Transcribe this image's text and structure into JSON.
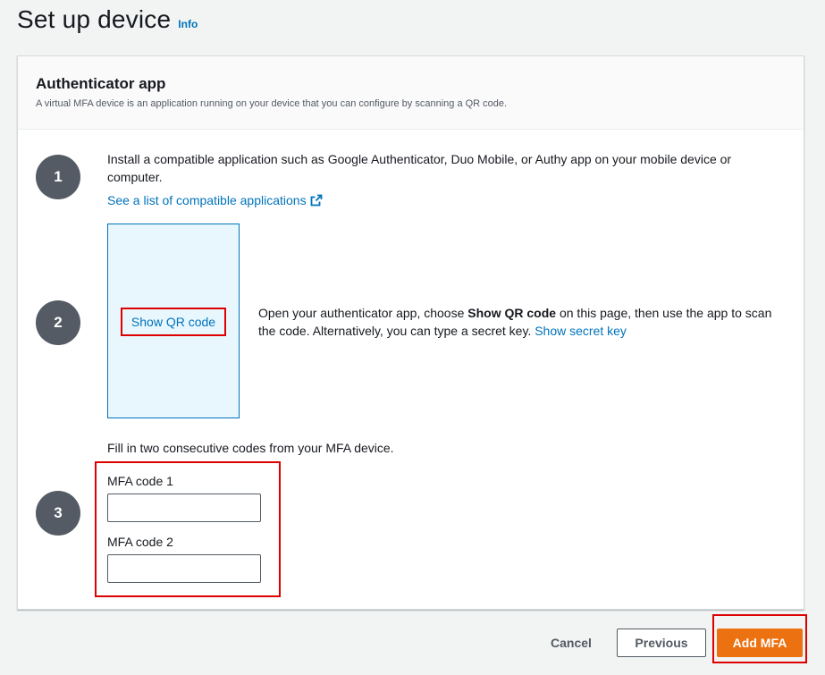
{
  "page": {
    "title": "Set up device",
    "info_label": "Info"
  },
  "card": {
    "title": "Authenticator app",
    "subtitle": "A virtual MFA device is an application running on your device that you can configure by scanning a QR code."
  },
  "steps": [
    {
      "number": "1",
      "text_line1": "Install a compatible application such as Google Authenticator, Duo Mobile, or Authy app on your mobile device or",
      "text_line2": "computer.",
      "link_label": "See a list of compatible applications"
    },
    {
      "number": "2",
      "qr_button_label": "Show QR code",
      "text_before": "Open your authenticator app, choose ",
      "text_bold": "Show QR code",
      "text_after": " on this page, then use the app to scan",
      "text_line2": "the code. Alternatively, you can type a secret key. ",
      "secret_link_label": "Show secret key"
    },
    {
      "number": "3",
      "instruction": "Fill in two consecutive codes from your MFA device.",
      "field1_label": "MFA code 1",
      "field1_value": "",
      "field2_label": "MFA code 2",
      "field2_value": ""
    }
  ],
  "footer": {
    "cancel_label": "Cancel",
    "previous_label": "Previous",
    "add_label": "Add MFA"
  },
  "colors": {
    "link": "#0073bb",
    "primary_button": "#ec7211",
    "step_circle": "#545b64",
    "highlight": "#dd0000",
    "qr_box_bg": "#e8f7fd"
  },
  "icons": {
    "external_link": "external-link-icon"
  }
}
